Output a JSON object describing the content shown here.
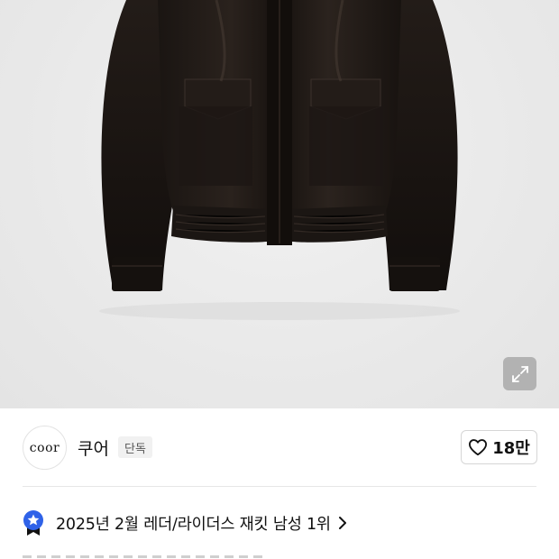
{
  "hero": {
    "image_alt": "black leather bomber jacket product photo",
    "expand_icon": "expand-icon"
  },
  "brand": {
    "logo_text": "coor",
    "name": "쿠어",
    "badge": "단독",
    "like_count": "18만",
    "like_icon": "heart-outline-icon"
  },
  "ranking": {
    "icon": "ranking-badge-star-icon",
    "text": "2025년 2월 레더/라이더스 재킷 남성 1위",
    "chevron_icon": "chevron-right-icon"
  },
  "colors": {
    "hero_background": "#ebebeb",
    "ranking_badge": "#2f62e8",
    "ranking_badge_ribbon": "#111111"
  }
}
